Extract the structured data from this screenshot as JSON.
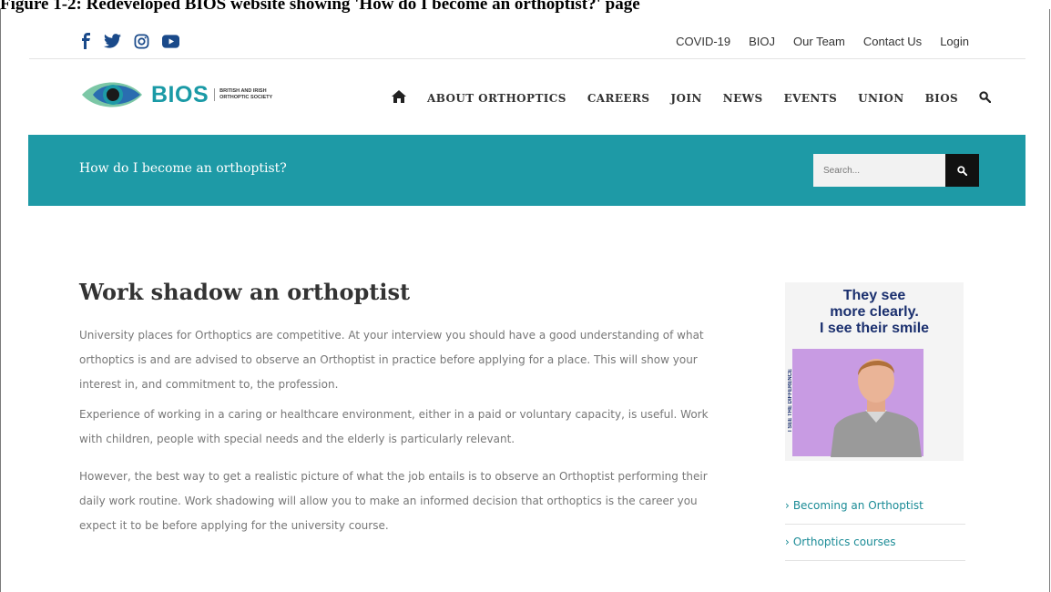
{
  "caption": "Figure 1-2: Redeveloped BIOS website showing 'How do I become an orthoptist?' page",
  "colors": {
    "brand_teal": "#1e9aa6",
    "nav_text": "#333333",
    "body_text": "#777777",
    "link_teal": "#1a8b96",
    "social_blue": "#1a4a8a"
  },
  "social": [
    {
      "name": "facebook-icon",
      "glyph": "f"
    },
    {
      "name": "twitter-icon",
      "glyph": ""
    },
    {
      "name": "instagram-icon",
      "glyph": ""
    },
    {
      "name": "youtube-icon",
      "glyph": ""
    }
  ],
  "top_links": [
    "COVID-19",
    "BIOJ",
    "Our Team",
    "Contact Us",
    "Login"
  ],
  "logo": {
    "text": "BIOS",
    "sub_line1": "BRITISH AND IRISH",
    "sub_line2": "ORTHOPTIC SOCIETY"
  },
  "nav": [
    "ABOUT ORTHOPTICS",
    "CAREERS",
    "JOIN",
    "NEWS",
    "EVENTS",
    "UNION",
    "BIOS"
  ],
  "banner": {
    "title": "How do I become an orthoptist?",
    "search_placeholder": "Search..."
  },
  "content": {
    "heading": "Work shadow an orthoptist",
    "paragraphs": [
      "University places for Orthoptics are competitive.  At your interview you should have a good understanding of what orthoptics is and are advised to observe an Orthoptist in practice before applying for a place. This will show your interest in, and commitment to, the profession.",
      "Experience of working in a caring or healthcare environment, either in a paid or voluntary capacity, is useful. Work with children, people with special needs and the elderly is particularly relevant.",
      "However, the best way to get a realistic picture of what the job entails is to observe an Orthoptist performing their daily work routine. Work shadowing will allow you to make an informed decision that orthoptics is the career you expect it to be before applying for the university course."
    ]
  },
  "sidebar": {
    "ad_line1": "They see",
    "ad_line2": "more clearly.",
    "ad_line3": "I see their smile",
    "ad_vertical": "I SEE THE DIFFERENCE",
    "links": [
      "Becoming an Orthoptist",
      "Orthoptics courses"
    ]
  }
}
